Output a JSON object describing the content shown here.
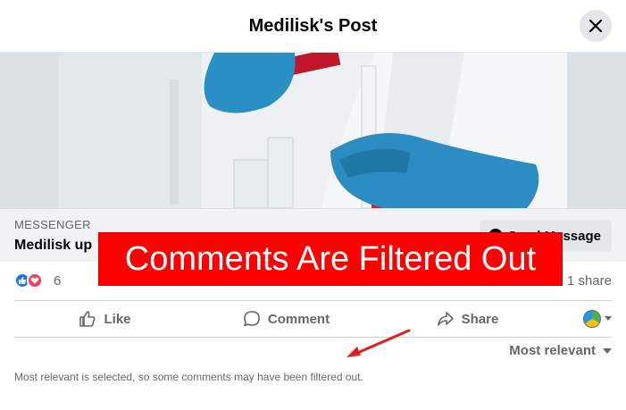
{
  "header": {
    "title": "Medilisk's Post",
    "close_icon": "close-icon"
  },
  "link_card": {
    "source": "MESSENGER",
    "title": "Medilisk up",
    "button_label": "Send Message"
  },
  "overlay": {
    "text": "Comments Are Filtered Out",
    "color": "#ff0000"
  },
  "reactions": {
    "icons": [
      "like-reaction-icon",
      "love-reaction-icon"
    ],
    "count": "6",
    "shares": "1 share"
  },
  "actions": {
    "like": "Like",
    "comment": "Comment",
    "share": "Share"
  },
  "comments": {
    "sort_label": "Most relevant",
    "filter_note": "Most relevant is selected, so some comments may have been filtered out."
  },
  "colors": {
    "accent": "#1877f2",
    "love": "#f33e58",
    "secondary_text": "#65676b",
    "annotation": "#e02020"
  }
}
